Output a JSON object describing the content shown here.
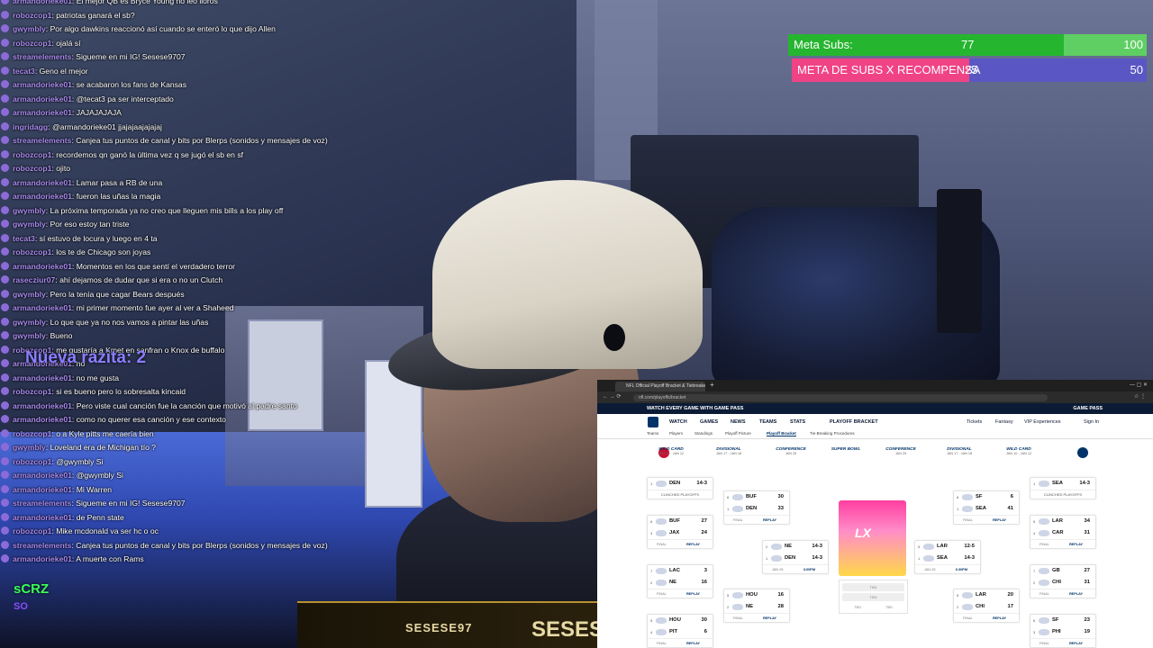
{
  "chat": {
    "messages": [
      {
        "user": "armandorieke01",
        "text": "El mejor QB es Bryce Young no leo lloros"
      },
      {
        "user": "robozcop1",
        "text": "patriotas ganará el sb?"
      },
      {
        "user": "gwymbly",
        "text": "Por algo dawkins reaccionó así cuando se enteró lo que dijo Allen"
      },
      {
        "user": "robozcop1",
        "text": "ojalá sí"
      },
      {
        "user": "streamelements",
        "text": "Sigueme en mi IG! Sesese9707"
      },
      {
        "user": "tecat3",
        "text": "Geno el mejor"
      },
      {
        "user": "armandorieke01",
        "text": "se acabaron los fans de Kansas"
      },
      {
        "user": "armandorieke01",
        "text": "@tecat3 pa ser interceptado"
      },
      {
        "user": "armandorieke01",
        "text": "JAJAJAJAJA"
      },
      {
        "user": "ingridagg",
        "text": "@armandorieke01 jjajajaajajajaj"
      },
      {
        "user": "streamelements",
        "text": "Canjea tus puntos de canal y bits por Blerps (sonidos y mensajes de voz)"
      },
      {
        "user": "robozcop1",
        "text": "recordemos qn ganó la última vez q se jugó el sb en sf"
      },
      {
        "user": "robozcop1",
        "text": "ojito"
      },
      {
        "user": "armandorieke01",
        "text": "Lamar pasa a RB de una"
      },
      {
        "user": "armandorieke01",
        "text": "fueron las uñas la magia"
      },
      {
        "user": "gwymbly",
        "text": "La próxima temporada ya no creo que lleguen mis bills a los play off"
      },
      {
        "user": "gwymbly",
        "text": "Por eso estoy tan triste"
      },
      {
        "user": "tecat3",
        "text": "sí estuvo de locura y luego en 4 ta"
      },
      {
        "user": "robozcop1",
        "text": "los te de Chicago son joyas"
      },
      {
        "user": "armandorieke01",
        "text": "Momentos en los que sentí el verdadero terror"
      },
      {
        "user": "rasecziur07",
        "text": "ahí dejamos de dudar que si era o no un Clutch"
      },
      {
        "user": "gwymbly",
        "text": "Pero la tenía que cagar Bears después"
      },
      {
        "user": "armandorieke01",
        "text": "mi primer momento fue ayer al ver a Shaheed"
      },
      {
        "user": "gwymbly",
        "text": "Lo que que ya no nos vamos a pintar las uñas"
      },
      {
        "user": "gwymbly",
        "text": "Bueno"
      },
      {
        "user": "robozcop1",
        "text": "me gustaría a Kmet en sanfran o Knox de buffalo"
      },
      {
        "user": "armandorieke01",
        "text": "no"
      },
      {
        "user": "armandorieke01",
        "text": "no me gusta"
      },
      {
        "user": "robozcop1",
        "text": "si es bueno pero lo sobresalta kincaid"
      },
      {
        "user": "armandorieke01",
        "text": "Pero viste cual canción fue la canción que motivó al padre santo"
      },
      {
        "user": "armandorieke01",
        "text": "como no querer esa canción y ese contexto"
      },
      {
        "user": "robozcop1",
        "text": "o a Kyle pitts me caería bien"
      },
      {
        "user": "gwymbly",
        "text": "Loveland era de Michigan tío ?"
      },
      {
        "user": "robozcop1",
        "text": "@gwymbly Si"
      },
      {
        "user": "armandorieke01",
        "text": "@gwymbly Si"
      },
      {
        "user": "armandorieke01",
        "text": "Mi Warren"
      },
      {
        "user": "streamelements",
        "text": "Sigueme en mi IG! Sesese9707"
      },
      {
        "user": "armandorieke01",
        "text": "de Penn state"
      },
      {
        "user": "robozcop1",
        "text": "Mike mcdonald va ser hc o oc"
      },
      {
        "user": "streamelements",
        "text": "Canjea tus puntos de canal y bits por Blerps (sonidos y mensajes de voz)"
      },
      {
        "user": "armandorieke01",
        "text": "A muerte con Rams"
      }
    ],
    "raid_text": "Nueva razita: 2",
    "badge_top": "sCRZ",
    "badge_bottom": "SO"
  },
  "goals": {
    "g1": {
      "label": "Meta Subs:",
      "current": "77",
      "target": "100",
      "progress": 0.77
    },
    "g2": {
      "label": "META DE SUBS X RECOMPENSA",
      "current": "25",
      "target": "50",
      "progress": 0.5
    }
  },
  "banner": {
    "tag": "SESESE97",
    "big": "SESESE"
  },
  "browser": {
    "tab_title": "NFL Official Playoff Bracket & Tiebreakers",
    "url": "nfl.com/playoffs/bracket",
    "promo_left": "WATCH EVERY GAME WITH GAME PASS",
    "promo_right": "GAME PASS",
    "nav": [
      "WATCH",
      "GAMES",
      "NEWS",
      "TEAMS",
      "STATS",
      "PLAYOFF BRACKET"
    ],
    "nav_right": [
      "Tickets",
      "Fantasy",
      "VIP Experiences",
      "Sign In"
    ],
    "subnav": [
      "Teams",
      "Players",
      "Standings",
      "Playoff Picture",
      "Playoff Bracket",
      "Tie-Breaking Procedures"
    ],
    "rounds": [
      {
        "name": "WILD CARD",
        "date": "JAN 10 - JAN 12"
      },
      {
        "name": "DIVISIONAL",
        "date": "JAN 17 - JAN 18"
      },
      {
        "name": "CONFERENCE",
        "date": "JAN 25"
      },
      {
        "name": "SUPER BOWL",
        "date": ""
      },
      {
        "name": "CONFERENCE",
        "date": "JAN 25"
      },
      {
        "name": "DIVISIONAL",
        "date": "JAN 17 - JAN 18"
      },
      {
        "name": "WILD CARD",
        "date": "JAN 10 - JAN 12"
      }
    ],
    "clinched": "CLINCHED PLAYOFFS",
    "final": "FINAL",
    "replay": "REPLAY",
    "tbd": "TBD",
    "sb_mark": "LX"
  },
  "bracket": {
    "afc_seed1": {
      "seed": "1",
      "team": "DEN",
      "score": "14-3"
    },
    "nfc_seed1": {
      "seed": "1",
      "team": "SEA",
      "score": "14-3"
    },
    "afc_wc": [
      {
        "a": {
          "seed": "6",
          "team": "BUF",
          "score": "27"
        },
        "b": {
          "seed": "3",
          "team": "JAX",
          "score": "24"
        }
      },
      {
        "a": {
          "seed": "7",
          "team": "LAC",
          "score": "3"
        },
        "b": {
          "seed": "2",
          "team": "NE",
          "score": "16"
        }
      },
      {
        "a": {
          "seed": "5",
          "team": "HOU",
          "score": "30"
        },
        "b": {
          "seed": "4",
          "team": "PIT",
          "score": "6"
        }
      }
    ],
    "afc_div": [
      {
        "a": {
          "seed": "6",
          "team": "BUF",
          "score": "30"
        },
        "b": {
          "seed": "1",
          "team": "DEN",
          "score": "33"
        }
      },
      {
        "a": {
          "seed": "5",
          "team": "HOU",
          "score": "16"
        },
        "b": {
          "seed": "2",
          "team": "NE",
          "score": "28"
        }
      }
    ],
    "afc_conf": {
      "a": {
        "seed": "2",
        "team": "NE",
        "score": "14-3"
      },
      "b": {
        "seed": "1",
        "team": "DEN",
        "score": "14-3"
      },
      "time": "JAN 25",
      "clock": "3:00PM"
    },
    "nfc_conf": {
      "a": {
        "seed": "5",
        "team": "LAR",
        "score": "12-5"
      },
      "b": {
        "seed": "1",
        "team": "SEA",
        "score": "14-3"
      },
      "time": "JAN 25",
      "clock": "6:30PM"
    },
    "nfc_div": [
      {
        "a": {
          "seed": "6",
          "team": "SF",
          "score": "6"
        },
        "b": {
          "seed": "1",
          "team": "SEA",
          "score": "41"
        }
      },
      {
        "a": {
          "seed": "5",
          "team": "LAR",
          "score": "20"
        },
        "b": {
          "seed": "2",
          "team": "CHI",
          "score": "17"
        }
      }
    ],
    "nfc_wc": [
      {
        "a": {
          "seed": "5",
          "team": "LAR",
          "score": "34"
        },
        "b": {
          "seed": "4",
          "team": "CAR",
          "score": "31"
        }
      },
      {
        "a": {
          "seed": "7",
          "team": "GB",
          "score": "27"
        },
        "b": {
          "seed": "2",
          "team": "CHI",
          "score": "31"
        }
      },
      {
        "a": {
          "seed": "6",
          "team": "SF",
          "score": "23"
        },
        "b": {
          "seed": "3",
          "team": "PHI",
          "score": "19"
        }
      }
    ]
  }
}
